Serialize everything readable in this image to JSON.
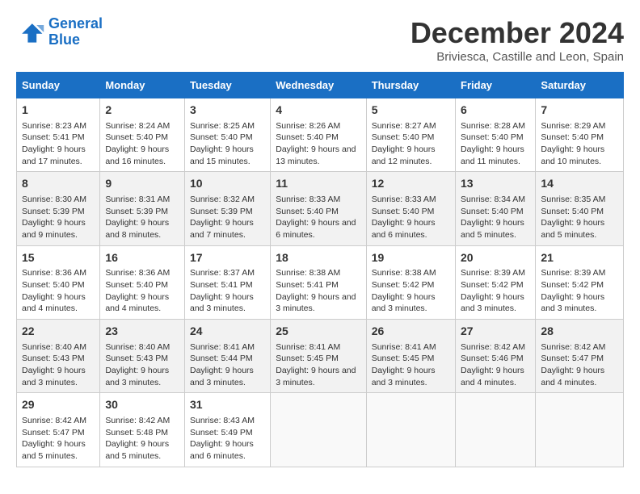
{
  "header": {
    "logo_line1": "General",
    "logo_line2": "Blue",
    "month": "December 2024",
    "location": "Briviesca, Castille and Leon, Spain"
  },
  "days_of_week": [
    "Sunday",
    "Monday",
    "Tuesday",
    "Wednesday",
    "Thursday",
    "Friday",
    "Saturday"
  ],
  "weeks": [
    [
      {
        "day": "1",
        "sunrise": "8:23 AM",
        "sunset": "5:41 PM",
        "daylight": "9 hours and 17 minutes."
      },
      {
        "day": "2",
        "sunrise": "8:24 AM",
        "sunset": "5:40 PM",
        "daylight": "9 hours and 16 minutes."
      },
      {
        "day": "3",
        "sunrise": "8:25 AM",
        "sunset": "5:40 PM",
        "daylight": "9 hours and 15 minutes."
      },
      {
        "day": "4",
        "sunrise": "8:26 AM",
        "sunset": "5:40 PM",
        "daylight": "9 hours and 13 minutes."
      },
      {
        "day": "5",
        "sunrise": "8:27 AM",
        "sunset": "5:40 PM",
        "daylight": "9 hours and 12 minutes."
      },
      {
        "day": "6",
        "sunrise": "8:28 AM",
        "sunset": "5:40 PM",
        "daylight": "9 hours and 11 minutes."
      },
      {
        "day": "7",
        "sunrise": "8:29 AM",
        "sunset": "5:40 PM",
        "daylight": "9 hours and 10 minutes."
      }
    ],
    [
      {
        "day": "8",
        "sunrise": "8:30 AM",
        "sunset": "5:39 PM",
        "daylight": "9 hours and 9 minutes."
      },
      {
        "day": "9",
        "sunrise": "8:31 AM",
        "sunset": "5:39 PM",
        "daylight": "9 hours and 8 minutes."
      },
      {
        "day": "10",
        "sunrise": "8:32 AM",
        "sunset": "5:39 PM",
        "daylight": "9 hours and 7 minutes."
      },
      {
        "day": "11",
        "sunrise": "8:33 AM",
        "sunset": "5:40 PM",
        "daylight": "9 hours and 6 minutes."
      },
      {
        "day": "12",
        "sunrise": "8:33 AM",
        "sunset": "5:40 PM",
        "daylight": "9 hours and 6 minutes."
      },
      {
        "day": "13",
        "sunrise": "8:34 AM",
        "sunset": "5:40 PM",
        "daylight": "9 hours and 5 minutes."
      },
      {
        "day": "14",
        "sunrise": "8:35 AM",
        "sunset": "5:40 PM",
        "daylight": "9 hours and 5 minutes."
      }
    ],
    [
      {
        "day": "15",
        "sunrise": "8:36 AM",
        "sunset": "5:40 PM",
        "daylight": "9 hours and 4 minutes."
      },
      {
        "day": "16",
        "sunrise": "8:36 AM",
        "sunset": "5:40 PM",
        "daylight": "9 hours and 4 minutes."
      },
      {
        "day": "17",
        "sunrise": "8:37 AM",
        "sunset": "5:41 PM",
        "daylight": "9 hours and 3 minutes."
      },
      {
        "day": "18",
        "sunrise": "8:38 AM",
        "sunset": "5:41 PM",
        "daylight": "9 hours and 3 minutes."
      },
      {
        "day": "19",
        "sunrise": "8:38 AM",
        "sunset": "5:42 PM",
        "daylight": "9 hours and 3 minutes."
      },
      {
        "day": "20",
        "sunrise": "8:39 AM",
        "sunset": "5:42 PM",
        "daylight": "9 hours and 3 minutes."
      },
      {
        "day": "21",
        "sunrise": "8:39 AM",
        "sunset": "5:42 PM",
        "daylight": "9 hours and 3 minutes."
      }
    ],
    [
      {
        "day": "22",
        "sunrise": "8:40 AM",
        "sunset": "5:43 PM",
        "daylight": "9 hours and 3 minutes."
      },
      {
        "day": "23",
        "sunrise": "8:40 AM",
        "sunset": "5:43 PM",
        "daylight": "9 hours and 3 minutes."
      },
      {
        "day": "24",
        "sunrise": "8:41 AM",
        "sunset": "5:44 PM",
        "daylight": "9 hours and 3 minutes."
      },
      {
        "day": "25",
        "sunrise": "8:41 AM",
        "sunset": "5:45 PM",
        "daylight": "9 hours and 3 minutes."
      },
      {
        "day": "26",
        "sunrise": "8:41 AM",
        "sunset": "5:45 PM",
        "daylight": "9 hours and 3 minutes."
      },
      {
        "day": "27",
        "sunrise": "8:42 AM",
        "sunset": "5:46 PM",
        "daylight": "9 hours and 4 minutes."
      },
      {
        "day": "28",
        "sunrise": "8:42 AM",
        "sunset": "5:47 PM",
        "daylight": "9 hours and 4 minutes."
      }
    ],
    [
      {
        "day": "29",
        "sunrise": "8:42 AM",
        "sunset": "5:47 PM",
        "daylight": "9 hours and 5 minutes."
      },
      {
        "day": "30",
        "sunrise": "8:42 AM",
        "sunset": "5:48 PM",
        "daylight": "9 hours and 5 minutes."
      },
      {
        "day": "31",
        "sunrise": "8:43 AM",
        "sunset": "5:49 PM",
        "daylight": "9 hours and 6 minutes."
      },
      null,
      null,
      null,
      null
    ]
  ]
}
